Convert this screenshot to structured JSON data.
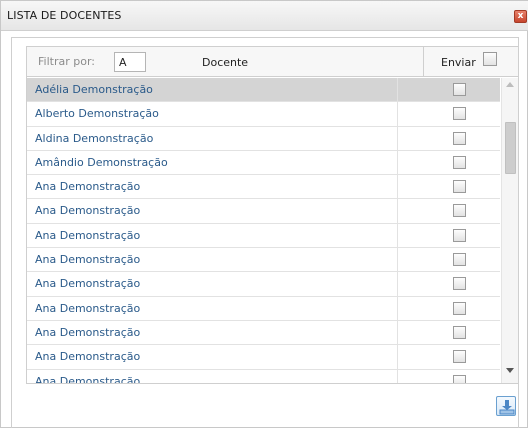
{
  "window": {
    "title": "LISTA DE DOCENTES",
    "close_glyph": "x"
  },
  "filter": {
    "label": "Filtrar por:",
    "value": "A"
  },
  "columns": {
    "docente": "Docente",
    "enviar": "Enviar"
  },
  "rows": [
    {
      "name": "Adélia Demonstração",
      "selected": true
    },
    {
      "name": "Alberto Demonstração",
      "selected": false
    },
    {
      "name": "Aldina Demonstração",
      "selected": false
    },
    {
      "name": "Amândio Demonstração",
      "selected": false
    },
    {
      "name": "Ana Demonstração",
      "selected": false
    },
    {
      "name": "Ana Demonstração",
      "selected": false
    },
    {
      "name": "Ana Demonstração",
      "selected": false
    },
    {
      "name": "Ana Demonstração",
      "selected": false
    },
    {
      "name": "Ana Demonstração",
      "selected": false
    },
    {
      "name": "Ana Demonstração",
      "selected": false
    },
    {
      "name": "Ana Demonstração",
      "selected": false
    },
    {
      "name": "Ana Demonstração",
      "selected": false
    },
    {
      "name": "Ana Demonstração",
      "selected": false
    }
  ],
  "icons": {
    "close": "close-icon",
    "download": "download-icon",
    "scroll_up": "scroll-up-arrow-icon",
    "scroll_down": "scroll-down-arrow-icon"
  },
  "colors": {
    "selected_row": "#d4d4d4",
    "name_text": "#2a5a8a",
    "close_button": "#c6452d",
    "download_accent": "#4a86c5"
  }
}
